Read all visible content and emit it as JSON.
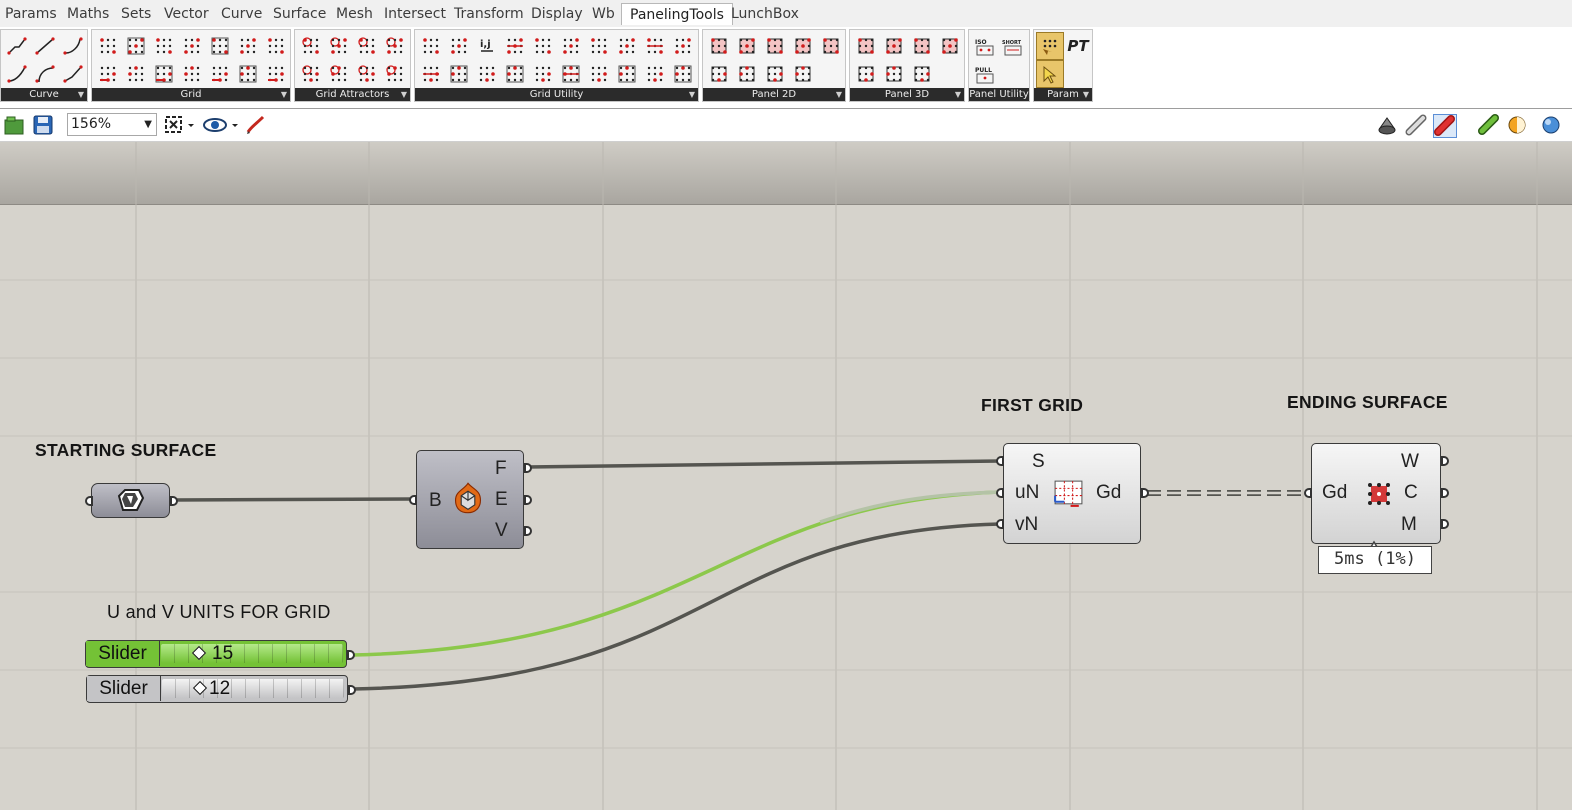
{
  "menu": {
    "tabs": [
      "Params",
      "Maths",
      "Sets",
      "Vector",
      "Curve",
      "Surface",
      "Mesh",
      "Intersect",
      "Transform",
      "Display",
      "Wb",
      "PanelingTools",
      "LunchBox"
    ],
    "active": "PanelingTools"
  },
  "ribbon": {
    "groups": [
      {
        "label": "Curve"
      },
      {
        "label": "Grid"
      },
      {
        "label": "Grid Attractors"
      },
      {
        "label": "Grid Utility"
      },
      {
        "label": "Panel 2D"
      },
      {
        "label": "Panel 3D"
      },
      {
        "label": "Panel Utility"
      },
      {
        "label": "Param"
      }
    ],
    "pt_label": "PT",
    "icon_texts": {
      "ij": "i,j",
      "iso": "ISO",
      "short": "SHORT",
      "pull": "PULL"
    }
  },
  "toolbar": {
    "zoom": "156%"
  },
  "canvas": {
    "groups": {
      "starting": "STARTING SURFACE",
      "first_grid": "FIRST GRID",
      "ending": "ENDING SURFACE",
      "uv_units": "U and V UNITS FOR GRID"
    },
    "brep": {
      "input": "B",
      "outputs": [
        "F",
        "E",
        "V"
      ]
    },
    "grid": {
      "inputs": [
        "S",
        "uN",
        "vN"
      ],
      "output": "Gd"
    },
    "ending_comp": {
      "input": "Gd",
      "outputs": [
        "W",
        "C",
        "M"
      ]
    },
    "sliders": [
      {
        "label": "Slider",
        "value": "15",
        "color": "#74c236"
      },
      {
        "label": "Slider",
        "value": "12",
        "color": "#c4c4c6"
      }
    ],
    "timer": "5ms (1%)"
  },
  "colors": {
    "canvas_bg": "#d6d3cc",
    "wire_dark": "#555550",
    "wire_green": "#8cc84b",
    "wire_faded": "#b4c3a6",
    "accent_red": "#d11b1b"
  }
}
